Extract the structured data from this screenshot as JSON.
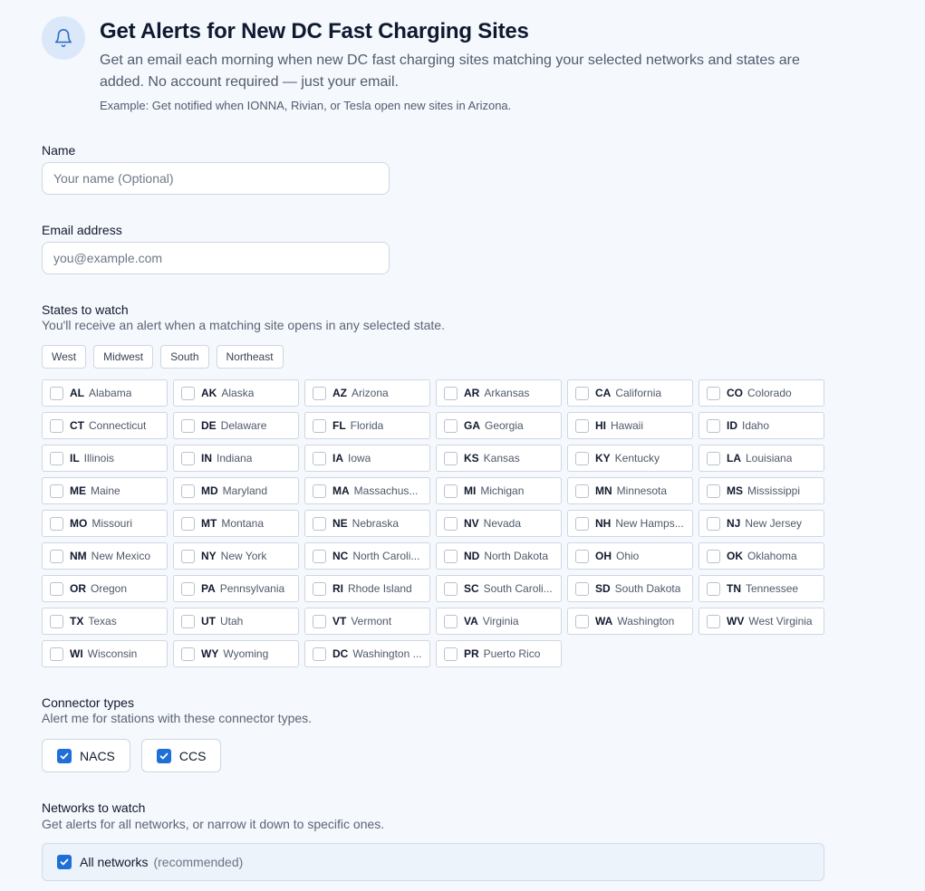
{
  "header": {
    "icon": "bell-icon",
    "title": "Get Alerts for New DC Fast Charging Sites",
    "subtitle_line1": "Get an email each morning when new DC fast charging sites matching your selected networks and states are",
    "subtitle_line2": "added. No account required — just your email.",
    "example": "Example: Get notified when IONNA, Rivian, or Tesla open new sites in Arizona."
  },
  "name_field": {
    "label": "Name",
    "placeholder": "Your name (Optional)",
    "value": ""
  },
  "email_field": {
    "label": "Email address",
    "placeholder": "you@example.com",
    "value": ""
  },
  "states": {
    "title": "States to watch",
    "subtitle": "You'll receive an alert when a matching site opens in any selected state.",
    "regions": [
      "West",
      "Midwest",
      "South",
      "Northeast"
    ],
    "items": [
      {
        "code": "AL",
        "name": "Alabama",
        "checked": false
      },
      {
        "code": "AK",
        "name": "Alaska",
        "checked": false
      },
      {
        "code": "AZ",
        "name": "Arizona",
        "checked": false
      },
      {
        "code": "AR",
        "name": "Arkansas",
        "checked": false
      },
      {
        "code": "CA",
        "name": "California",
        "checked": false
      },
      {
        "code": "CO",
        "name": "Colorado",
        "checked": false
      },
      {
        "code": "CT",
        "name": "Connecticut",
        "checked": false
      },
      {
        "code": "DE",
        "name": "Delaware",
        "checked": false
      },
      {
        "code": "FL",
        "name": "Florida",
        "checked": false
      },
      {
        "code": "GA",
        "name": "Georgia",
        "checked": false
      },
      {
        "code": "HI",
        "name": "Hawaii",
        "checked": false
      },
      {
        "code": "ID",
        "name": "Idaho",
        "checked": false
      },
      {
        "code": "IL",
        "name": "Illinois",
        "checked": false
      },
      {
        "code": "IN",
        "name": "Indiana",
        "checked": false
      },
      {
        "code": "IA",
        "name": "Iowa",
        "checked": false
      },
      {
        "code": "KS",
        "name": "Kansas",
        "checked": false
      },
      {
        "code": "KY",
        "name": "Kentucky",
        "checked": false
      },
      {
        "code": "LA",
        "name": "Louisiana",
        "checked": false
      },
      {
        "code": "ME",
        "name": "Maine",
        "checked": false
      },
      {
        "code": "MD",
        "name": "Maryland",
        "checked": false
      },
      {
        "code": "MA",
        "name": "Massachus...",
        "checked": false
      },
      {
        "code": "MI",
        "name": "Michigan",
        "checked": false
      },
      {
        "code": "MN",
        "name": "Minnesota",
        "checked": false
      },
      {
        "code": "MS",
        "name": "Mississippi",
        "checked": false
      },
      {
        "code": "MO",
        "name": "Missouri",
        "checked": false
      },
      {
        "code": "MT",
        "name": "Montana",
        "checked": false
      },
      {
        "code": "NE",
        "name": "Nebraska",
        "checked": false
      },
      {
        "code": "NV",
        "name": "Nevada",
        "checked": false
      },
      {
        "code": "NH",
        "name": "New Hamps...",
        "checked": false
      },
      {
        "code": "NJ",
        "name": "New Jersey",
        "checked": false
      },
      {
        "code": "NM",
        "name": "New Mexico",
        "checked": false
      },
      {
        "code": "NY",
        "name": "New York",
        "checked": false
      },
      {
        "code": "NC",
        "name": "North Caroli...",
        "checked": false
      },
      {
        "code": "ND",
        "name": "North Dakota",
        "checked": false
      },
      {
        "code": "OH",
        "name": "Ohio",
        "checked": false
      },
      {
        "code": "OK",
        "name": "Oklahoma",
        "checked": false
      },
      {
        "code": "OR",
        "name": "Oregon",
        "checked": false
      },
      {
        "code": "PA",
        "name": "Pennsylvania",
        "checked": false
      },
      {
        "code": "RI",
        "name": "Rhode Island",
        "checked": false
      },
      {
        "code": "SC",
        "name": "South Caroli...",
        "checked": false
      },
      {
        "code": "SD",
        "name": "South Dakota",
        "checked": false
      },
      {
        "code": "TN",
        "name": "Tennessee",
        "checked": false
      },
      {
        "code": "TX",
        "name": "Texas",
        "checked": false
      },
      {
        "code": "UT",
        "name": "Utah",
        "checked": false
      },
      {
        "code": "VT",
        "name": "Vermont",
        "checked": false
      },
      {
        "code": "VA",
        "name": "Virginia",
        "checked": false
      },
      {
        "code": "WA",
        "name": "Washington",
        "checked": false
      },
      {
        "code": "WV",
        "name": "West Virginia",
        "checked": false
      },
      {
        "code": "WI",
        "name": "Wisconsin",
        "checked": false
      },
      {
        "code": "WY",
        "name": "Wyoming",
        "checked": false
      },
      {
        "code": "DC",
        "name": "Washington ...",
        "checked": false
      },
      {
        "code": "PR",
        "name": "Puerto Rico",
        "checked": false
      }
    ]
  },
  "connectors": {
    "title": "Connector types",
    "subtitle": "Alert me for stations with these connector types.",
    "items": [
      {
        "label": "NACS",
        "checked": true
      },
      {
        "label": "CCS",
        "checked": true
      }
    ]
  },
  "networks": {
    "title": "Networks to watch",
    "subtitle": "Get alerts for all networks, or narrow it down to specific ones.",
    "all_label": "All networks",
    "all_note": "(recommended)",
    "all_checked": true
  },
  "colors": {
    "accent": "#1f6fd9",
    "background": "#f5f8fc",
    "icon_bg": "#dbe8fa"
  }
}
